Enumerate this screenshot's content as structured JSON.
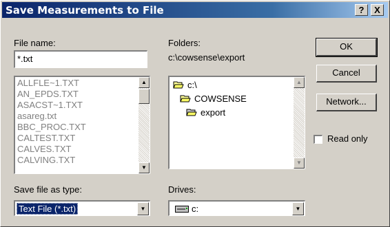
{
  "window": {
    "title": "Save Measurements to File",
    "help_glyph": "?",
    "close_glyph": "X"
  },
  "file_name": {
    "label": "File name:",
    "value": "*.txt",
    "files": [
      "ALLFLE~1.TXT",
      "AN_EPDS.TXT",
      "ASACST~1.TXT",
      "asareg.txt",
      "BBC_PROC.TXT",
      "CALTEST.TXT",
      "CALVES.TXT",
      "CALVING.TXT"
    ]
  },
  "folders": {
    "label": "Folders:",
    "current_path": "c:\\cowsense\\export",
    "items": [
      {
        "name": "c:\\",
        "icon": "open-folder-icon"
      },
      {
        "name": "COWSENSE",
        "icon": "open-folder-icon"
      },
      {
        "name": "export",
        "icon": "open-folder-icon"
      }
    ]
  },
  "file_type": {
    "label": "Save file as type:",
    "value": "Text File (*.txt)"
  },
  "drives": {
    "label": "Drives:",
    "value": "c:",
    "icon": "drive-icon"
  },
  "buttons": {
    "ok": "OK",
    "cancel": "Cancel",
    "network": "Network..."
  },
  "read_only": {
    "label": "Read only",
    "checked": false
  },
  "colors": {
    "title_bar": "#0a246a",
    "selection": "#0a246a",
    "face": "#d4d0c8"
  }
}
